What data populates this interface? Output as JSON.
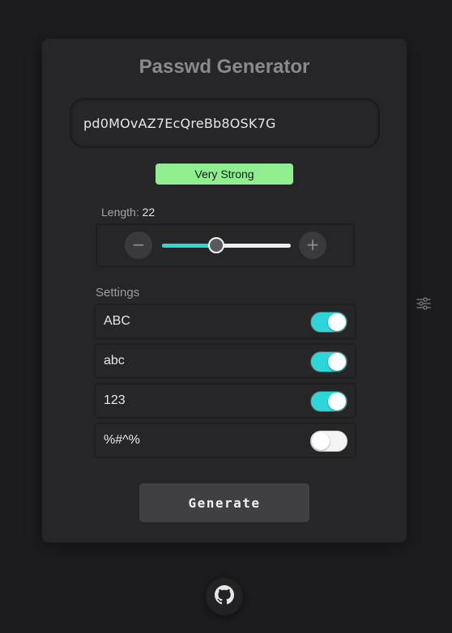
{
  "app": {
    "title": "Passwd Generator"
  },
  "password": {
    "value": "pd0MOvAZ7EcQreBb8OSK7G"
  },
  "strength": {
    "label": "Very Strong",
    "color": "#90ee90"
  },
  "length": {
    "label": "Length:",
    "value": "22",
    "slider_fraction": 0.42,
    "decrement_icon": "minus-icon",
    "increment_icon": "plus-icon",
    "decrement_glyph": "−",
    "increment_glyph": "+"
  },
  "settings": {
    "label": "Settings",
    "options": [
      {
        "label": "ABC",
        "enabled": true
      },
      {
        "label": "abc",
        "enabled": true
      },
      {
        "label": "123",
        "enabled": true
      },
      {
        "label": "%#^%",
        "enabled": false
      }
    ]
  },
  "generate": {
    "label": "Generate"
  },
  "icons": {
    "side_settings": "sliders-icon",
    "footer": "github-icon"
  },
  "colors": {
    "accent": "#2ed6d9",
    "background": "#1c1b1d",
    "card": "#262528",
    "strength_badge": "#90ee90"
  }
}
